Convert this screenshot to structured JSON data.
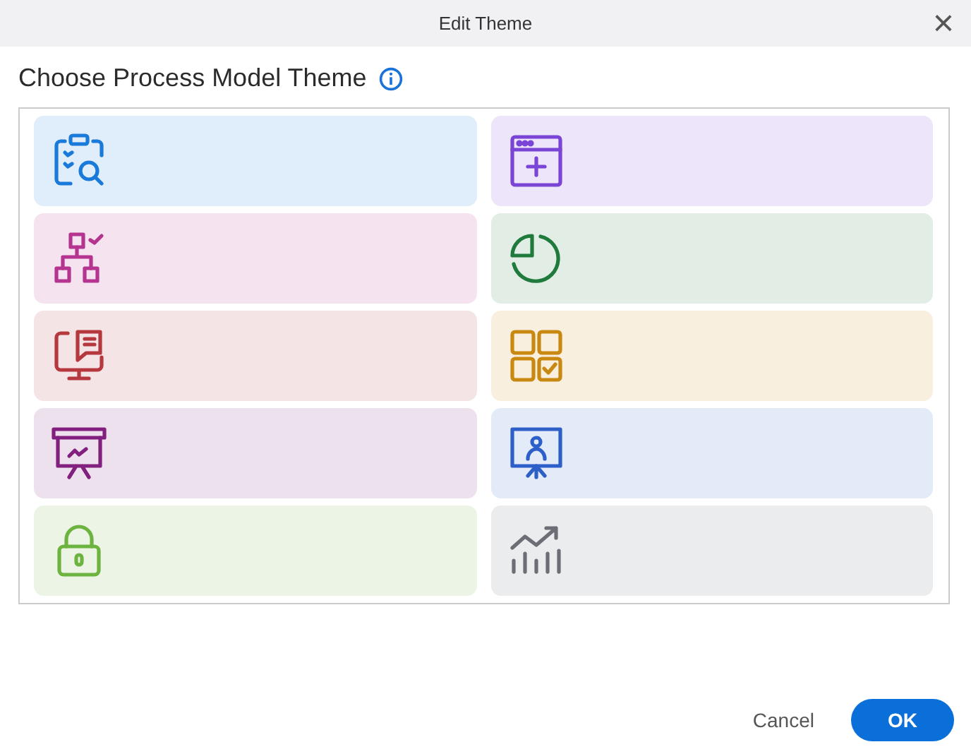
{
  "window": {
    "title": "Edit Theme",
    "close": "×"
  },
  "heading": "Choose Process Model Theme",
  "themes": [
    {
      "kind": "clipboard",
      "color": "#1a7ad9"
    },
    {
      "kind": "browser",
      "color": "#7a45d6"
    },
    {
      "kind": "hierarchy",
      "color": "#b5348f"
    },
    {
      "kind": "pie",
      "color": "#1f7a3c"
    },
    {
      "kind": "monitor",
      "color": "#b5383e"
    },
    {
      "kind": "grid",
      "color": "#c98810"
    },
    {
      "kind": "easel",
      "color": "#82207f"
    },
    {
      "kind": "presenter",
      "color": "#2d5fc9"
    },
    {
      "kind": "lock",
      "color": "#6db33f"
    },
    {
      "kind": "trend",
      "color": "#6b6e75"
    }
  ],
  "buttons": [
    {
      "label": "Cancel",
      "kind": "text"
    },
    {
      "label": "OK",
      "kind": "primary"
    }
  ]
}
